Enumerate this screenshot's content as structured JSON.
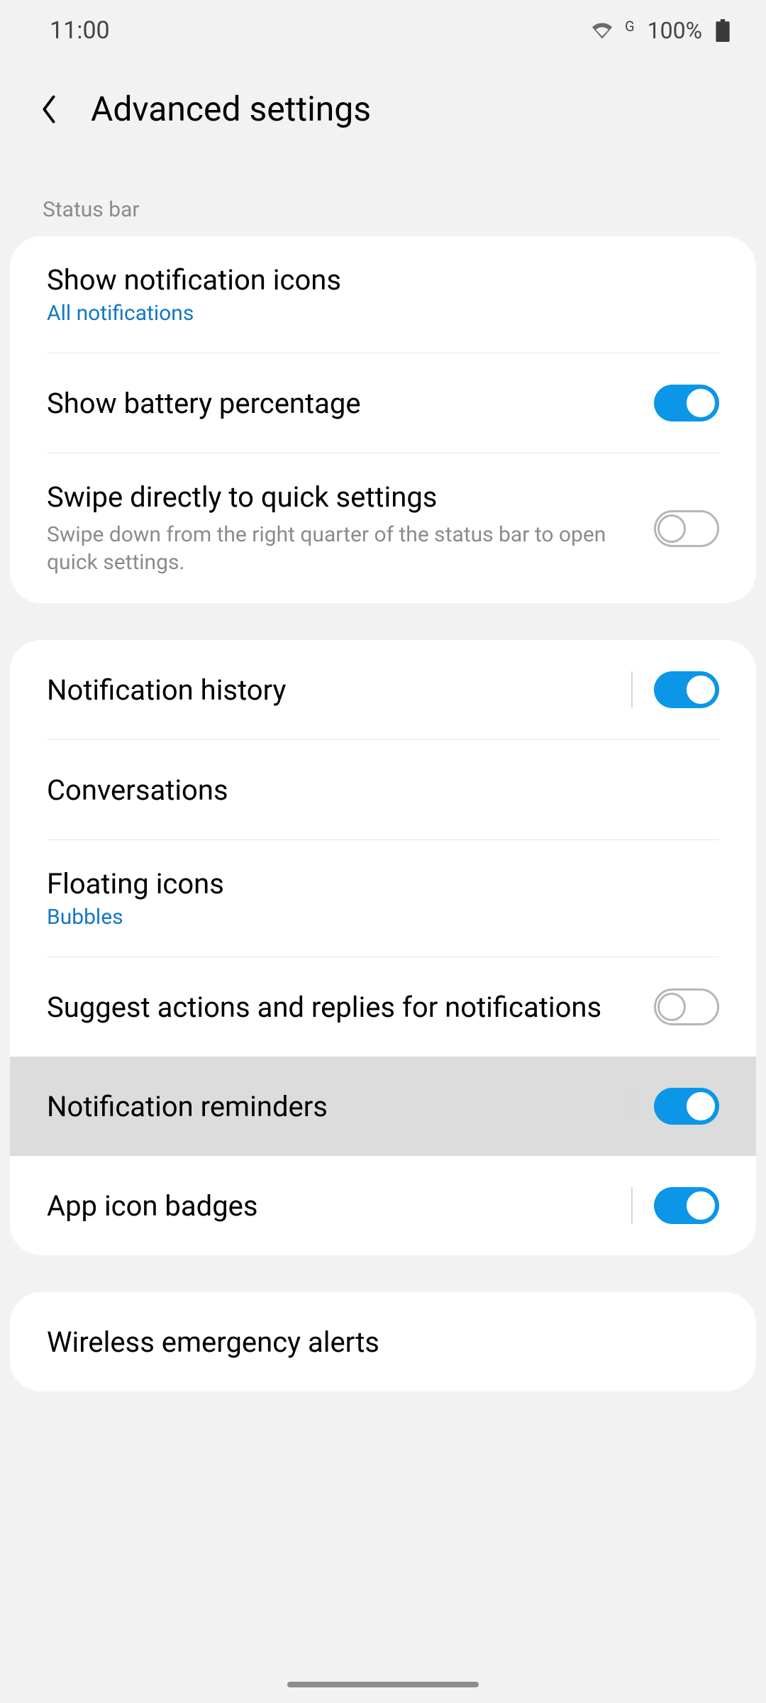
{
  "statusbar": {
    "time": "11:00",
    "network_label": "G",
    "battery_pct": "100%"
  },
  "header": {
    "title": "Advanced settings"
  },
  "sections": {
    "status_bar_label": "Status bar"
  },
  "items": {
    "show_notification_icons": {
      "title": "Show notification icons",
      "sub": "All notifications"
    },
    "show_battery_percentage": {
      "title": "Show battery percentage",
      "on": true
    },
    "swipe_quick_settings": {
      "title": "Swipe directly to quick settings",
      "sub": "Swipe down from the right quarter of the status bar to open quick settings.",
      "on": false
    },
    "notification_history": {
      "title": "Notification history",
      "on": true
    },
    "conversations": {
      "title": "Conversations"
    },
    "floating_icons": {
      "title": "Floating icons",
      "sub": "Bubbles"
    },
    "suggest_actions": {
      "title": "Suggest actions and replies for notifications",
      "on": false
    },
    "notification_reminders": {
      "title": "Notification reminders",
      "on": true
    },
    "app_icon_badges": {
      "title": "App icon badges",
      "on": true
    },
    "wireless_emergency_alerts": {
      "title": "Wireless emergency alerts"
    }
  }
}
